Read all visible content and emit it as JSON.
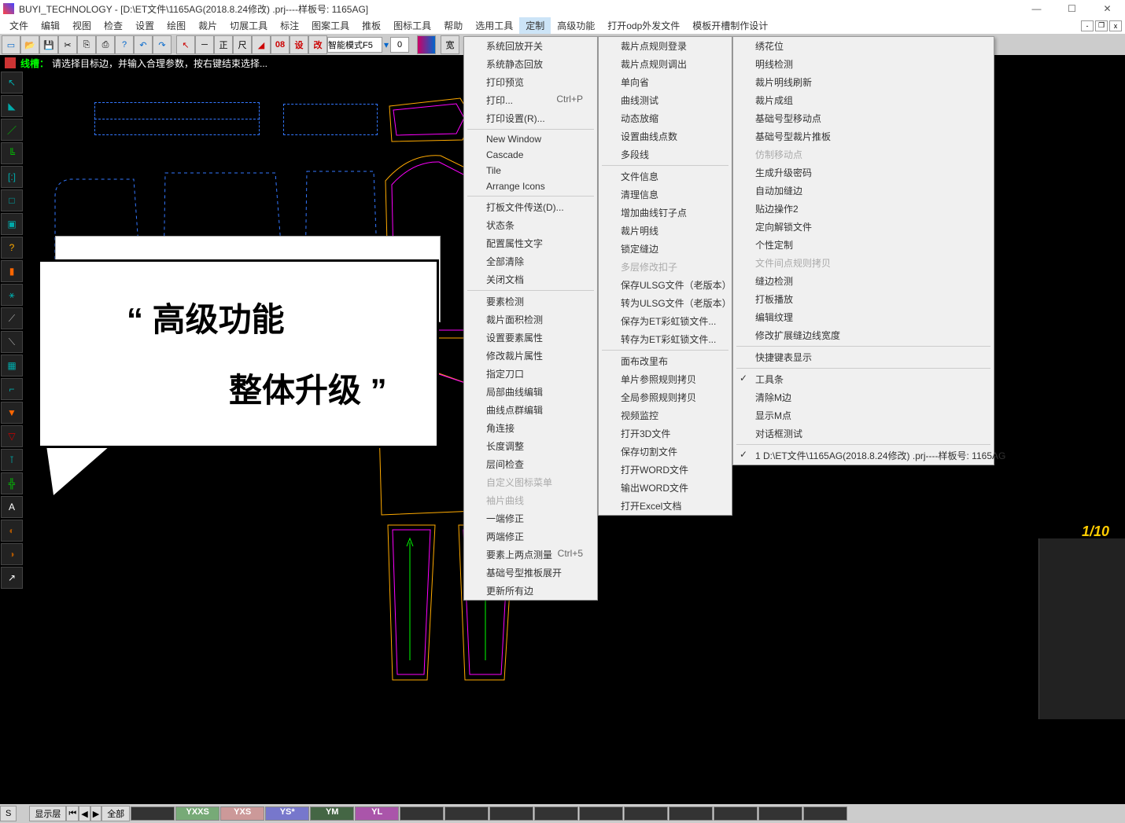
{
  "title": "BUYI_TECHNOLOGY - [D:\\ET文件\\1165AG(2018.8.24修改)  .prj----样板号: 1165AG]",
  "menubar": [
    "文件",
    "编辑",
    "视图",
    "检查",
    "设置",
    "绘图",
    "裁片",
    "切展工具",
    "标注",
    "图案工具",
    "推板",
    "图标工具",
    "帮助",
    "选用工具",
    "定制",
    "高级功能",
    "打开odp外发文件",
    "模板开槽制作设计"
  ],
  "active_menu_index": 14,
  "toolbar": {
    "mode_input": "智能模式F5",
    "num_input": "0",
    "red_08": "08",
    "red_she": "设",
    "red_gai": "改",
    "kuan": "宽"
  },
  "status": {
    "label": "线槽：",
    "text": "请选择目标边，并输入合理参数，按右键结束选择..."
  },
  "dropdown1": {
    "groups": [
      [
        "系统回放开关",
        "系统静态回放",
        "打印预览",
        {
          "t": "打印...",
          "s": "Ctrl+P"
        },
        "打印设置(R)..."
      ],
      [
        "New Window",
        "Cascade",
        "Tile",
        "Arrange Icons"
      ],
      [
        "打板文件传送(D)...",
        "状态条",
        "配置属性文字",
        "全部清除",
        "关闭文档"
      ],
      [
        "要素检测",
        "裁片面积检测",
        "设置要素属性",
        "修改裁片属性",
        "指定刀口",
        "局部曲线编辑",
        "曲线点群编辑",
        "角连接",
        "长度调整",
        "层间检查",
        {
          "t": "自定义图标菜单",
          "d": true
        },
        {
          "t": "袖片曲线",
          "d": true
        },
        "一端修正",
        "两端修正",
        {
          "t": "要素上两点测量",
          "s": "Ctrl+5"
        },
        "基础号型推板展开",
        "更新所有边"
      ]
    ]
  },
  "dropdown2": {
    "groups": [
      [
        "裁片点规则登录",
        "裁片点规则调出",
        "单向省",
        "曲线测试",
        "动态放缩",
        "设置曲线点数",
        "多段线"
      ],
      [
        "文件信息",
        "清理信息",
        "增加曲线钉子点",
        "裁片明线",
        "锁定缝边",
        {
          "t": "多层修改扣子",
          "d": true
        },
        "保存ULSG文件（老版本）",
        "转为ULSG文件（老版本）",
        "保存为ET彩虹锁文件...",
        "转存为ET彩虹锁文件..."
      ],
      [
        "面布改里布",
        "单片参照规则拷贝",
        "全局参照规则拷贝",
        "视频监控",
        "打开3D文件",
        "保存切割文件",
        "打开WORD文件",
        "输出WORD文件",
        "打开Excel文档"
      ]
    ]
  },
  "dropdown3": {
    "groups": [
      [
        "绣花位",
        "明线检测",
        "裁片明线刷新",
        "裁片成组",
        "基础号型移动点",
        "基础号型裁片推板",
        {
          "t": "仿制移动点",
          "d": true
        },
        "生成升级密码",
        "自动加缝边",
        "贴边操作2",
        "定向解锁文件",
        "个性定制",
        {
          "t": "文件间点规则拷贝",
          "d": true
        },
        "缝边检测",
        "打板播放",
        "编辑纹理",
        "修改扩展缝边线宽度"
      ],
      [
        "快捷键表显示"
      ],
      [
        {
          "t": "工具条",
          "c": true
        },
        "清除M边",
        "显示M点",
        "对话框测试"
      ],
      [
        {
          "t": "1 D:\\ET文件\\1165AG(2018.8.24修改)  .prj----样板号: 1165AG",
          "c": true
        }
      ]
    ]
  },
  "callout": {
    "line1": "“ 高级功能",
    "line2": "整体升级 ”"
  },
  "footer": {
    "s": "S",
    "layer": "显示层",
    "all": "全部",
    "sizes": [
      {
        "t": "",
        "c": "#333"
      },
      {
        "t": "YXXS",
        "c": "#7a7"
      },
      {
        "t": "YXS",
        "c": "#c99"
      },
      {
        "t": "YS*",
        "c": "#77c"
      },
      {
        "t": "YM",
        "c": "#464"
      },
      {
        "t": "YL",
        "c": "#a5a"
      },
      {
        "t": "",
        "c": "#333"
      },
      {
        "t": "",
        "c": "#333"
      },
      {
        "t": "",
        "c": "#333"
      },
      {
        "t": "",
        "c": "#333"
      },
      {
        "t": "",
        "c": "#333"
      },
      {
        "t": "",
        "c": "#333"
      },
      {
        "t": "",
        "c": "#333"
      },
      {
        "t": "",
        "c": "#333"
      },
      {
        "t": "",
        "c": "#333"
      },
      {
        "t": "",
        "c": "#333"
      }
    ]
  },
  "counter": "1/10",
  "side_icons": [
    "↖",
    "◣",
    "／",
    "╚",
    "[:]",
    "□",
    "▣",
    "?",
    "▮",
    "⚹",
    "⟋",
    "⟍",
    "▦",
    "⌐",
    "▼",
    "▽",
    "⊺",
    "╬",
    "A",
    "◐",
    "◑",
    "↗"
  ]
}
